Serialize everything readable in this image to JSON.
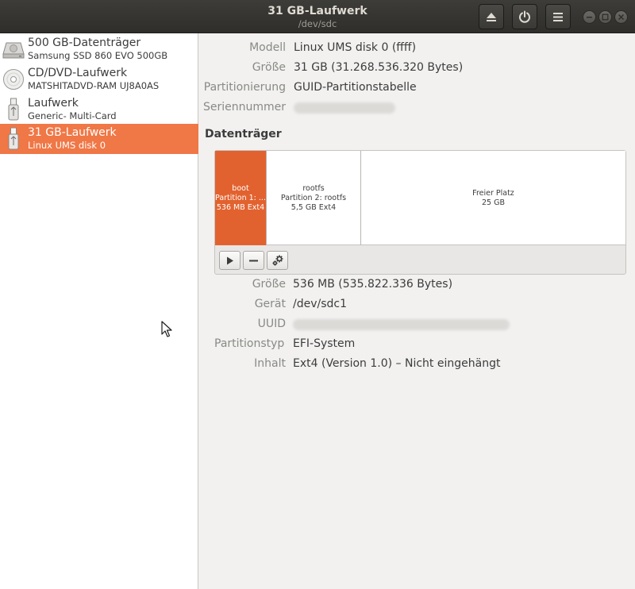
{
  "window": {
    "title": "31 GB-Laufwerk",
    "subtitle": "/dev/sdc"
  },
  "header_icons": {
    "eject": "eject-icon",
    "power": "power-icon",
    "menu": "hamburger-menu-icon"
  },
  "sidebar": {
    "devices": [
      {
        "name": "500 GB-Datenträger",
        "sub": "Samsung SSD 860 EVO 500GB",
        "icon": "hard-disk-icon"
      },
      {
        "name": "CD/DVD-Laufwerk",
        "sub": "MATSHITADVD-RAM UJ8A0AS",
        "icon": "optical-disc-icon"
      },
      {
        "name": "Laufwerk",
        "sub": "Generic- Multi-Card",
        "icon": "usb-drive-icon"
      },
      {
        "name": "31 GB-Laufwerk",
        "sub": "Linux UMS disk 0",
        "icon": "usb-drive-icon",
        "selected": true
      }
    ]
  },
  "drive": {
    "model_label": "Modell",
    "model": "Linux UMS disk 0 (ffff)",
    "size_label": "Größe",
    "size": "31 GB (31.268.536.320 Bytes)",
    "partitioning_label": "Partitionierung",
    "partitioning": "GUID-Partitionstabelle",
    "serial_label": "Seriennummer"
  },
  "volumes": {
    "heading": "Datenträger",
    "partitions": [
      {
        "line1": "boot",
        "line2": "Partition 1: ...",
        "line3": "536 MB Ext4",
        "selected": true
      },
      {
        "line1": "rootfs",
        "line2": "Partition 2: rootfs",
        "line3": "5,5 GB Ext4"
      },
      {
        "line1": "Freier Platz",
        "line2": "25 GB"
      }
    ]
  },
  "partition": {
    "size_label": "Größe",
    "size": "536 MB (535.822.336 Bytes)",
    "device_label": "Gerät",
    "device": "/dev/sdc1",
    "uuid_label": "UUID",
    "type_label": "Partitionstyp",
    "type": "EFI-System",
    "contents_label": "Inhalt",
    "contents": "Ext4 (Version 1.0) – Nicht eingehängt"
  },
  "colors": {
    "accent": "#f07746",
    "selected_partition": "#e2622f",
    "titlebar": "#3b3a36"
  }
}
